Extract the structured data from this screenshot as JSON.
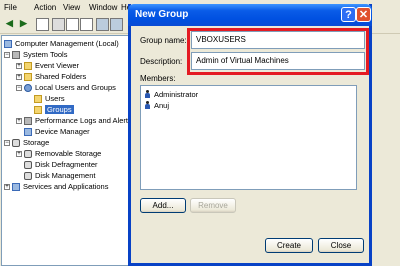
{
  "menubar": {
    "items": [
      "File",
      "Action",
      "View",
      "Window",
      "He"
    ]
  },
  "tree": [
    {
      "label": "Computer Management (Local)"
    },
    {
      "label": "System Tools"
    },
    {
      "label": "Event Viewer"
    },
    {
      "label": "Shared Folders"
    },
    {
      "label": "Local Users and Groups"
    },
    {
      "label": "Users"
    },
    {
      "label": "Groups"
    },
    {
      "label": "Performance Logs and Alerts"
    },
    {
      "label": "Device Manager"
    },
    {
      "label": "Storage"
    },
    {
      "label": "Removable Storage"
    },
    {
      "label": "Disk Defragmenter"
    },
    {
      "label": "Disk Management"
    },
    {
      "label": "Services and Applications"
    }
  ],
  "dialog": {
    "title": "New Group",
    "help_label": "?",
    "close_label": "✕",
    "group_name_label": "Group name:",
    "group_name_value": "VBOXUSERS",
    "description_label": "Description:",
    "description_value": "Admin of Virtual Machines",
    "members_label": "Members:",
    "members": [
      "Administrator",
      "Anuj"
    ],
    "add_label": "Add...",
    "remove_label": "Remove",
    "create_label": "Create",
    "close_button_label": "Close"
  },
  "colors": {
    "highlight": "#e41b23",
    "titlebar": "#0a5ce8",
    "selection": "#316ac5"
  }
}
